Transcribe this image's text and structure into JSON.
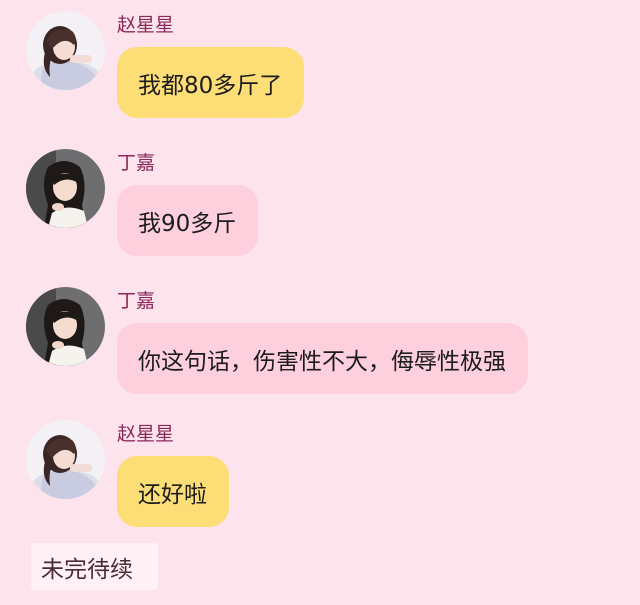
{
  "messages": [
    {
      "sender": "赵星星",
      "text": "我都80多斤了",
      "bubble_color": "#fddd76"
    },
    {
      "sender": "丁嘉",
      "text": "我90多斤",
      "bubble_color": "#fecfdc"
    },
    {
      "sender": "丁嘉",
      "text": "你这句话，伤害性不大，侮辱性极强",
      "bubble_color": "#fecfdc"
    },
    {
      "sender": "赵星星",
      "text": "还好啦",
      "bubble_color": "#fddd76"
    }
  ],
  "footer": {
    "label": "未完待续"
  },
  "colors": {
    "background": "#fde3ec",
    "sender_name": "#8a2a5a",
    "yellow_bubble": "#fddd76",
    "pink_bubble": "#fecfdc"
  },
  "icons": {
    "avatar_zhao": "avatar-zhao-xingxing-icon",
    "avatar_ding": "avatar-ding-jia-icon"
  }
}
